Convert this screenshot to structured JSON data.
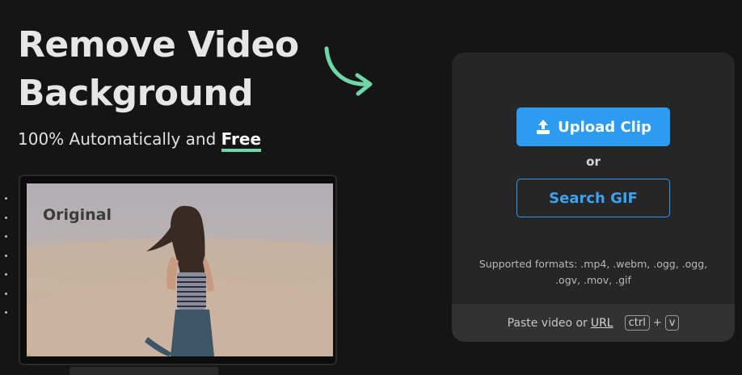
{
  "hero": {
    "title_line1": "Remove Video",
    "title_line2": "Background",
    "subtitle_prefix": "100% Automatically and ",
    "subtitle_highlight": "Free"
  },
  "preview": {
    "label": "Original"
  },
  "upload_card": {
    "upload_button": "Upload Clip",
    "or_text": "or",
    "search_button": "Search GIF",
    "supported_formats": "Supported formats: .mp4, .webm, .ogg, .ogg, .ogv, .mov, .gif",
    "paste_text": "Paste video or",
    "paste_url": "URL",
    "kbd_ctrl": "ctrl",
    "kbd_plus": "+",
    "kbd_v": "v"
  },
  "colors": {
    "background": "#161516",
    "accent_blue": "#2d9bf0",
    "accent_green": "#6fd6a8",
    "card": "#262626"
  },
  "icons": [
    "upload-icon",
    "curved-arrow-icon"
  ]
}
